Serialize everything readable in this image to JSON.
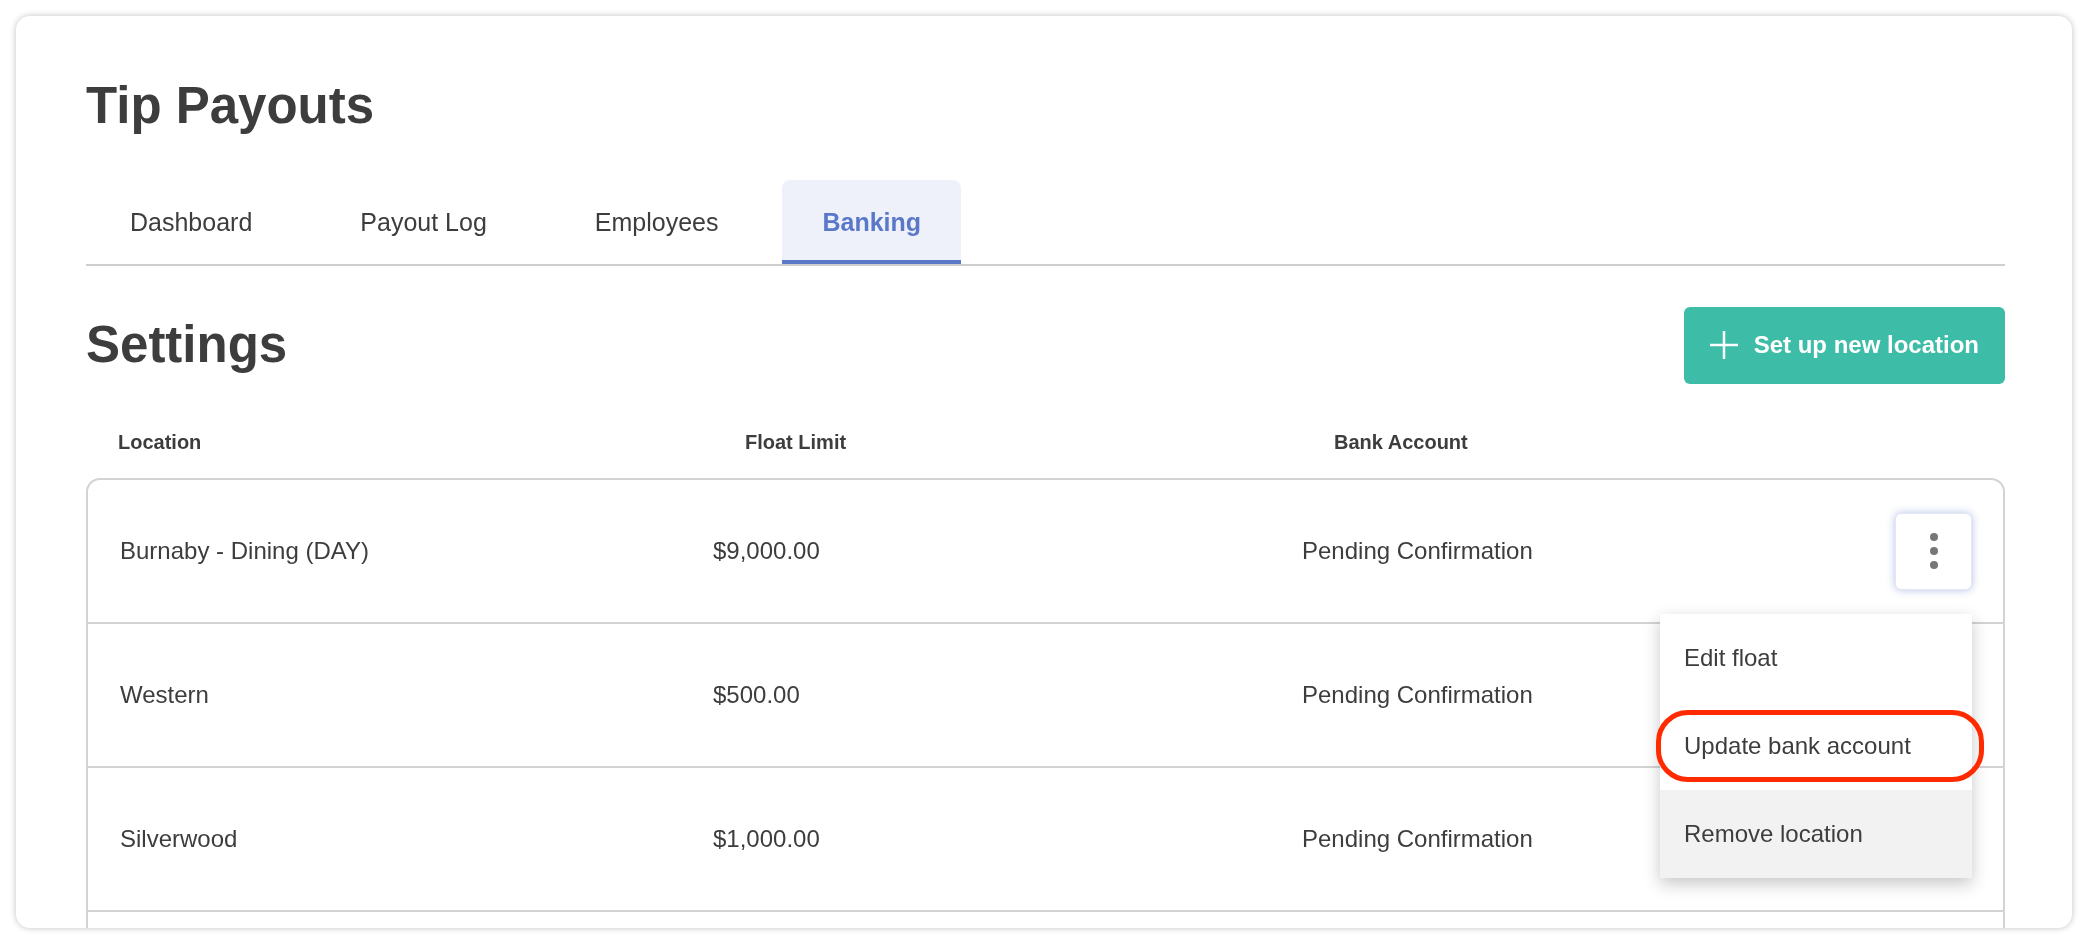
{
  "page": {
    "title": "Tip Payouts"
  },
  "tabs": [
    {
      "label": "Dashboard",
      "selected": false
    },
    {
      "label": "Payout Log",
      "selected": false
    },
    {
      "label": "Employees",
      "selected": false
    },
    {
      "label": "Banking",
      "selected": true
    }
  ],
  "section": {
    "title": "Settings",
    "action_button": {
      "label": "Set up new location"
    }
  },
  "table": {
    "columns": [
      "Location",
      "Float Limit",
      "Bank Account"
    ],
    "rows": [
      {
        "location": "Burnaby - Dining (DAY)",
        "float_limit": "$9,000.00",
        "bank_account": "Pending Confirmation",
        "menu_open": true
      },
      {
        "location": "Western",
        "float_limit": "$500.00",
        "bank_account": "Pending Confirmation",
        "menu_open": false
      },
      {
        "location": "Silverwood",
        "float_limit": "$1,000.00",
        "bank_account": "Pending Confirmation",
        "menu_open": false
      }
    ]
  },
  "row_menu": {
    "items": [
      {
        "label": "Edit float",
        "highlighted": false,
        "circled": false
      },
      {
        "label": "Update bank account",
        "highlighted": false,
        "circled": true
      },
      {
        "label": "Remove location",
        "highlighted": true,
        "circled": false
      }
    ]
  }
}
